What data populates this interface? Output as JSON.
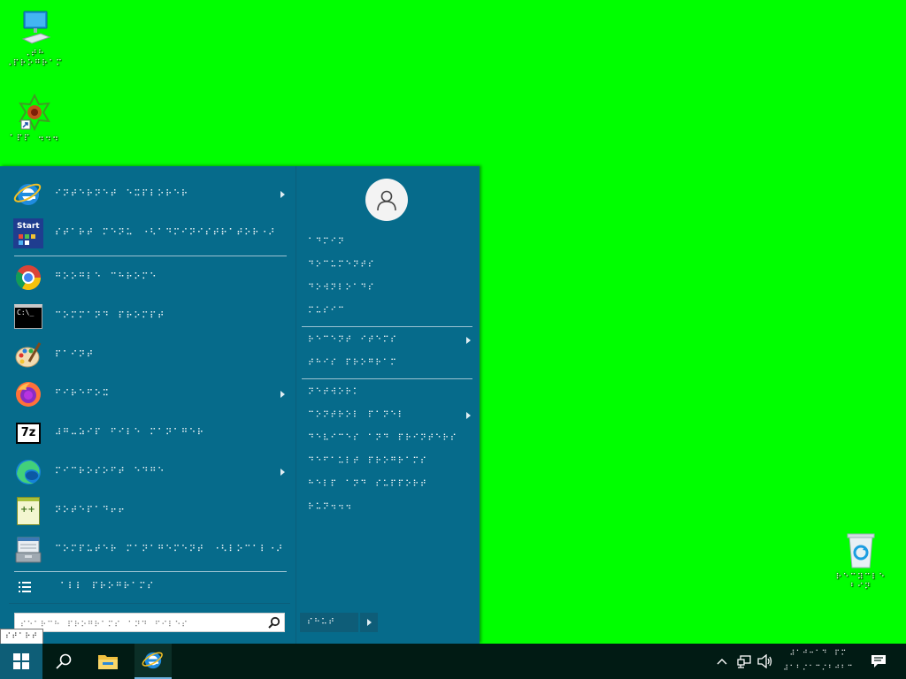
{
  "desktop": {
    "icons": [
      {
        "label_line1": "⠠⠞⠓",
        "label_line2": "⠠⠏⠗⠕⠛⠗⠁⠍"
      },
      {
        "label": "⠁⠏⠏⠀⠲⠲⠲"
      },
      {
        "label_line1": "⠗⠑⠉⠽⠉⠇⠑",
        "label_line2": "⠃⠊⠝"
      }
    ]
  },
  "start_menu": {
    "apps": [
      {
        "name": "⠊⠝⠞⠑⠗⠝⠑⠞⠀⠑⠭⠏⠇⠕⠗⠑⠗",
        "icon": "internet-explorer-icon",
        "has_submenu": true
      },
      {
        "name": "⠎⠞⠁⠗⠞⠀⠍⠑⠝⠥⠀⠐⠣⠁⠙⠍⠊⠝⠊⠎⠞⠗⠁⠞⠕⠗⠐⠜",
        "icon": "start-menu-config-icon",
        "icon_text": "Start",
        "has_submenu": false
      },
      {
        "name": "⠛⠕⠕⠛⠇⠑⠀⠉⠓⠗⠕⠍⠑",
        "icon": "chrome-icon",
        "has_submenu": false
      },
      {
        "name": "⠉⠕⠍⠍⠁⠝⠙⠀⠏⠗⠕⠍⠏⠞",
        "icon": "command-prompt-icon",
        "icon_text": "C:\\_",
        "has_submenu": false
      },
      {
        "name": "⠏⠁⠊⠝⠞",
        "icon": "paint-icon",
        "has_submenu": false
      },
      {
        "name": "⠋⠊⠗⠑⠋⠕⠭",
        "icon": "firefox-icon",
        "has_submenu": true
      },
      {
        "name": "⠼⠛⠤⠵⠊⠏⠀⠋⠊⠇⠑⠀⠍⠁⠝⠁⠛⠑⠗",
        "icon": "7zip-icon",
        "icon_text": "7z",
        "has_submenu": false
      },
      {
        "name": "⠍⠊⠉⠗⠕⠎⠕⠋⠞⠀⠑⠙⠛⠑",
        "icon": "edge-icon",
        "has_submenu": true
      },
      {
        "name": "⠝⠕⠞⠑⠏⠁⠙⠖⠖",
        "icon": "notepad-plus-plus-icon",
        "icon_text": "++",
        "has_submenu": false
      },
      {
        "name": "⠉⠕⠍⠏⠥⠞⠑⠗⠀⠍⠁⠝⠁⠛⠑⠍⠑⠝⠞⠀⠐⠣⠇⠕⠉⠁⠇⠐⠜",
        "icon": "computer-management-icon",
        "has_submenu": false
      }
    ],
    "all_programs_label": "⠁⠇⠇⠀⠏⠗⠕⠛⠗⠁⠍⠎",
    "search_placeholder": "⠎⠑⠁⠗⠉⠓⠀⠏⠗⠕⠛⠗⠁⠍⠎⠀⠁⠝⠙⠀⠋⠊⠇⠑⠎",
    "right_items": [
      {
        "label": "⠁⠙⠍⠊⠝",
        "has_submenu": false
      },
      {
        "label": "⠙⠕⠉⠥⠍⠑⠝⠞⠎",
        "has_submenu": false
      },
      {
        "label": "⠙⠕⠺⠝⠇⠕⠁⠙⠎",
        "has_submenu": false
      },
      {
        "label": "⠍⠥⠎⠊⠉",
        "has_submenu": false
      },
      {
        "label": "⠗⠑⠉⠑⠝⠞⠀⠊⠞⠑⠍⠎",
        "has_submenu": true
      },
      {
        "label": "⠞⠓⠊⠎⠀⠏⠗⠕⠛⠗⠁⠍",
        "has_submenu": false
      },
      {
        "label": "⠝⠑⠞⠺⠕⠗⠅",
        "has_submenu": false
      },
      {
        "label": "⠉⠕⠝⠞⠗⠕⠇⠀⠏⠁⠝⠑⠇",
        "has_submenu": true
      },
      {
        "label": "⠙⠑⠧⠊⠉⠑⠎⠀⠁⠝⠙⠀⠏⠗⠊⠝⠞⠑⠗⠎",
        "has_submenu": false
      },
      {
        "label": "⠙⠑⠋⠁⠥⠇⠞⠀⠏⠗⠕⠛⠗⠁⠍⠎",
        "has_submenu": false
      },
      {
        "label": "⠓⠑⠇⠏⠀⠁⠝⠙⠀⠎⠥⠏⠏⠕⠗⠞",
        "has_submenu": false
      },
      {
        "label": "⠗⠥⠝⠲⠲⠲",
        "has_submenu": false
      }
    ],
    "shutdown_label": "⠎⠓⠥⠞",
    "tooltip": "⠎⠞⠁⠗⠞"
  },
  "taskbar": {
    "clock_time": "⠼⠁⠚⠒⠁⠙⠀⠏⠍",
    "clock_date": "⠼⠁⠃⠌⠁⠉⠌⠃⠚⠃⠉"
  },
  "colors": {
    "desktop_bg": "#00ff00",
    "start_menu_bg": "#066b8b",
    "taskbar_bg": "#011b14"
  }
}
